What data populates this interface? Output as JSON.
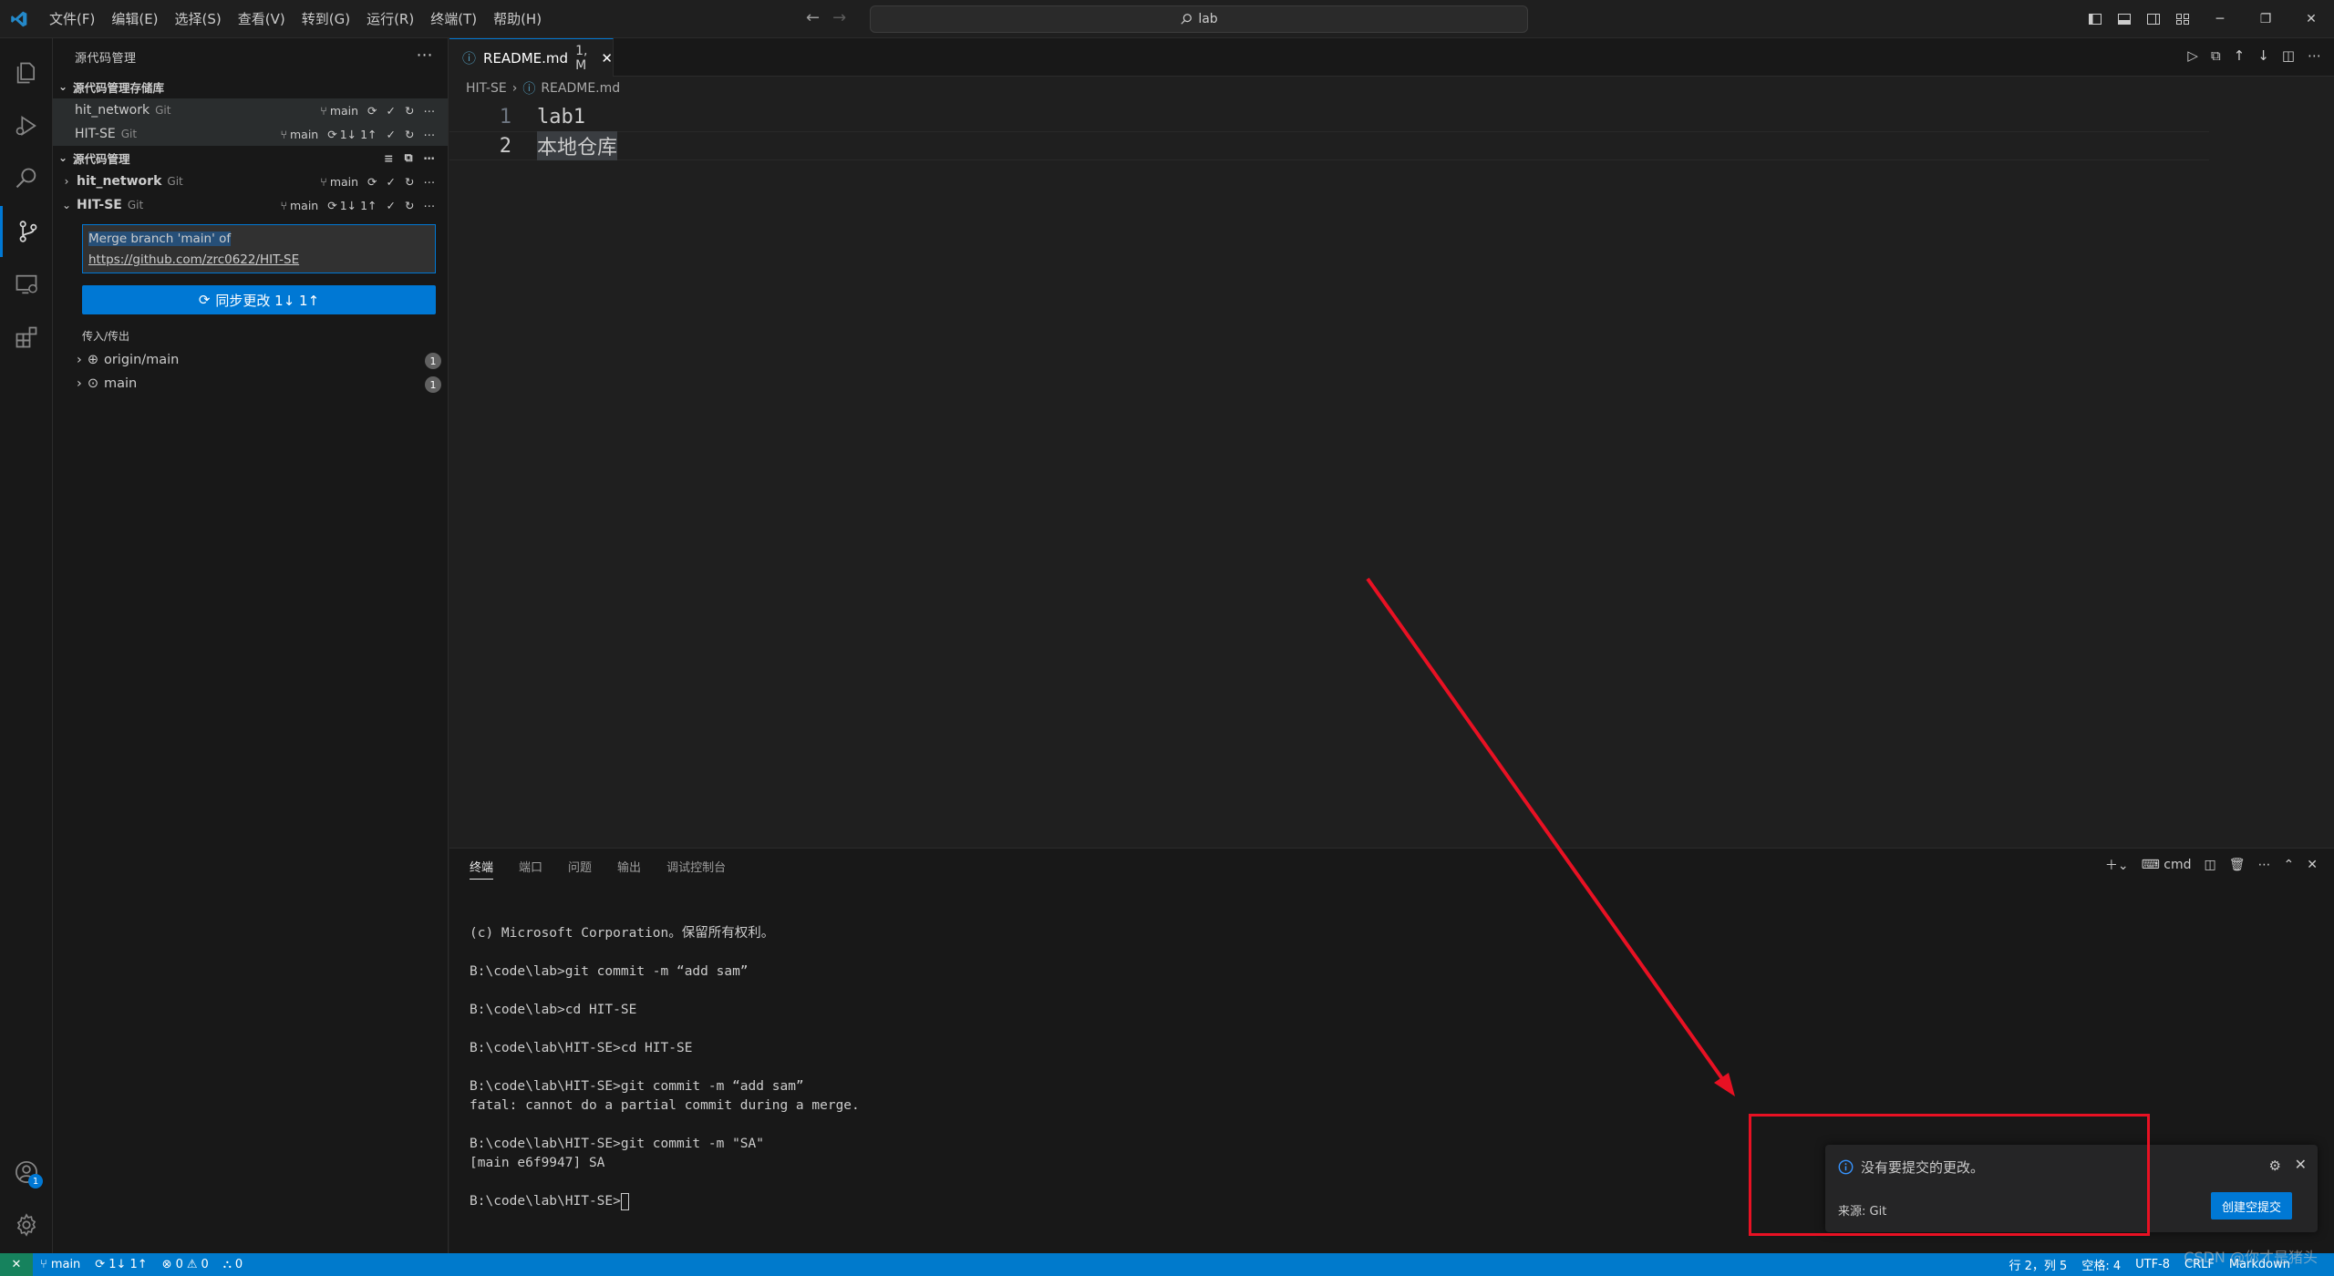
{
  "menu": [
    "文件(F)",
    "编辑(E)",
    "选择(S)",
    "查看(V)",
    "转到(G)",
    "运行(R)",
    "终端(T)",
    "帮助(H)"
  ],
  "search": {
    "text": "lab"
  },
  "sidebar": {
    "title": "源代码管理",
    "repos_section": "源代码管理存储库",
    "repos": [
      {
        "name": "hit_network",
        "kind": "Git",
        "branch": "main",
        "sync": ""
      },
      {
        "name": "HIT-SE",
        "kind": "Git",
        "branch": "main",
        "sync": "1↓ 1↑"
      }
    ],
    "changes_section": "源代码管理",
    "groups": [
      {
        "name": "hit_network",
        "kind": "Git",
        "branch": "main",
        "sync": ""
      },
      {
        "name": "HIT-SE",
        "kind": "Git",
        "branch": "main",
        "sync": "1↓ 1↑"
      }
    ],
    "commit_message_line1": "Merge branch 'main' of",
    "commit_message_line2": "https://github.com/zrc0622/HIT-SE",
    "sync_button": "同步更改 1↓ 1↑",
    "inout_label": "传入/传出",
    "inout": [
      {
        "name": "origin/main",
        "count": "1"
      },
      {
        "name": "main",
        "count": "1"
      }
    ]
  },
  "editor": {
    "tab_name": "README.md",
    "tab_status": "1, M",
    "breadcrumb": [
      "HIT-SE",
      "README.md"
    ],
    "lines": [
      {
        "number": "1",
        "text": "lab1"
      },
      {
        "number": "2",
        "text": "本地仓库"
      }
    ]
  },
  "panel": {
    "tabs": [
      "终端",
      "端口",
      "问题",
      "输出",
      "调试控制台"
    ],
    "shell": "cmd",
    "terminal_lines": [
      "(c) Microsoft Corporation。保留所有权利。",
      "",
      "B:\\code\\lab>git commit -m “add sam”",
      "",
      "B:\\code\\lab>cd HIT-SE",
      "",
      "B:\\code\\lab\\HIT-SE>cd HIT-SE",
      "",
      "B:\\code\\lab\\HIT-SE>git commit -m “add sam”",
      "fatal: cannot do a partial commit during a merge.",
      "",
      "B:\\code\\lab\\HIT-SE>git commit -m \"SA\"",
      "[main e6f9947] SA",
      ""
    ],
    "prompt": "B:\\code\\lab\\HIT-SE>"
  },
  "notification": {
    "message": "没有要提交的更改。",
    "source": "来源: Git",
    "button": "创建空提交"
  },
  "statusbar": {
    "branch": "main",
    "sync": "1↓ 1↑",
    "errors": "0",
    "warnings": "0",
    "ports": "0",
    "position": "行 2，列 5",
    "spaces": "空格: 4",
    "encoding": "UTF-8",
    "eol": "CRLF",
    "language": "Markdown"
  },
  "watermark": "CSDN @你才是猪头",
  "accounts_badge": "1",
  "colors": {
    "accent": "#0078d4",
    "statusbar": "#007acc",
    "annotation": "#e81123"
  }
}
